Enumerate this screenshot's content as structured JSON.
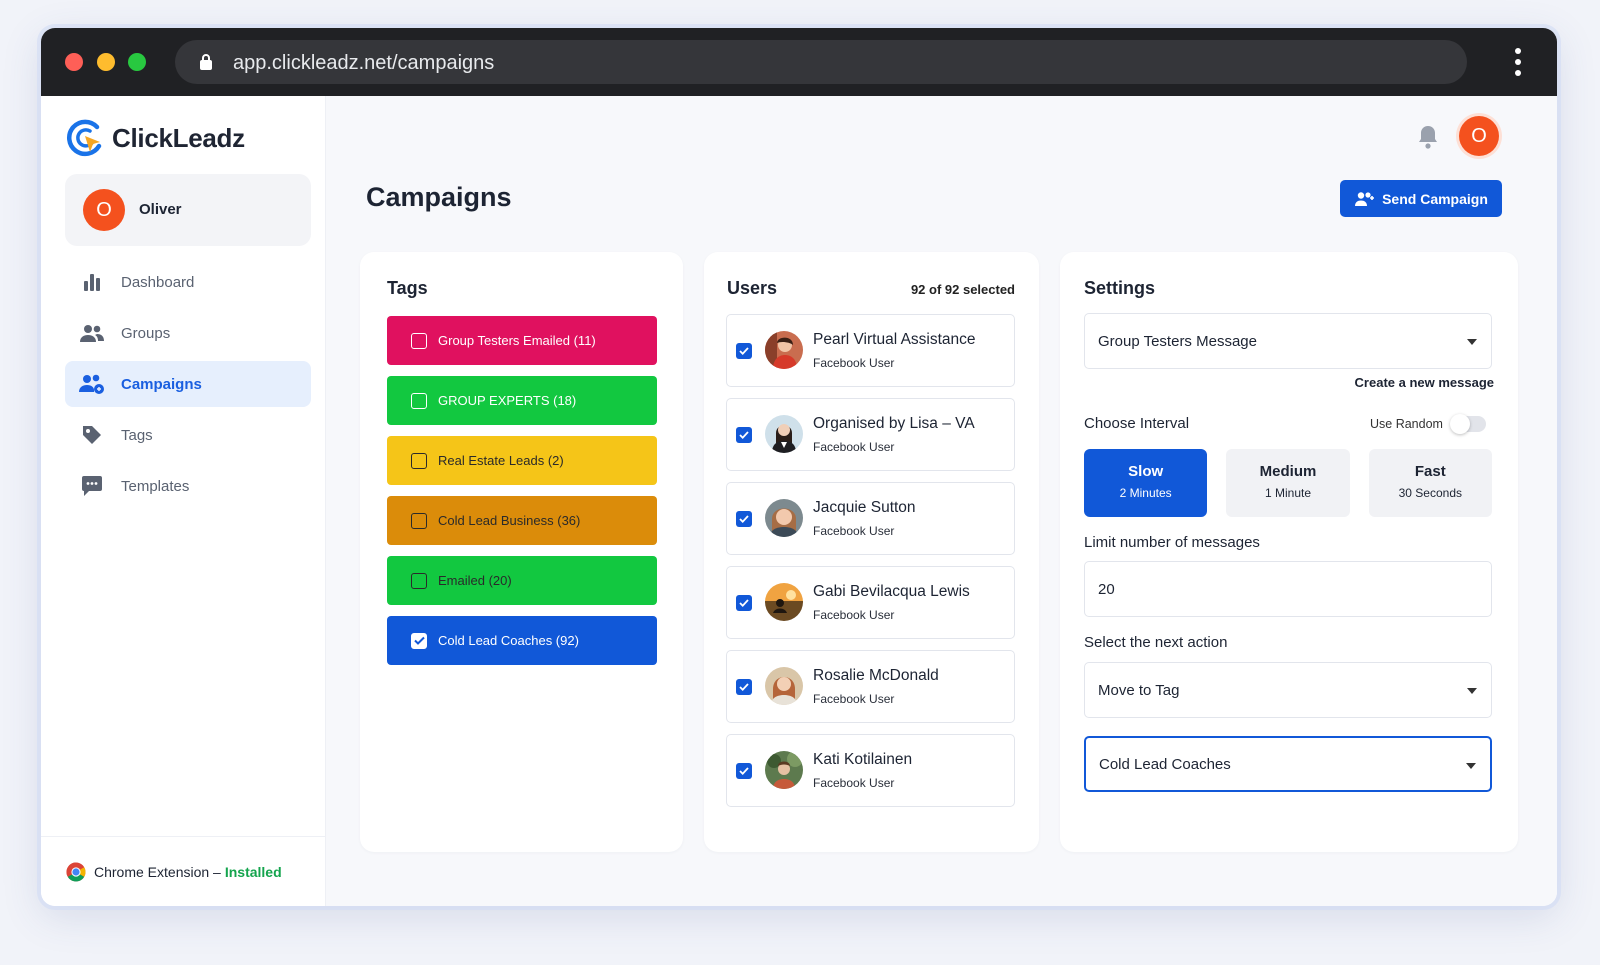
{
  "browser": {
    "url": "app.clickleadz.net/campaigns"
  },
  "app": {
    "brand": "ClickLeadz",
    "accent_color": "#1158d8"
  },
  "user": {
    "name": "Oliver",
    "initial": "O",
    "avatar_color": "#f4511e"
  },
  "sidebar": {
    "items": [
      {
        "label": "Dashboard",
        "icon": "bar-chart-icon",
        "active": false
      },
      {
        "label": "Groups",
        "icon": "group-icon",
        "active": false
      },
      {
        "label": "Campaigns",
        "icon": "campaign-users-icon",
        "active": true
      },
      {
        "label": "Tags",
        "icon": "tag-icon",
        "active": false
      },
      {
        "label": "Templates",
        "icon": "chat-bubble-icon",
        "active": false
      }
    ],
    "footer": {
      "label": "Chrome Extension –",
      "status": "Installed",
      "icon": "chrome-icon"
    }
  },
  "header": {
    "title": "Campaigns",
    "send_label": "Send Campaign",
    "bell_icon": "bell-icon"
  },
  "tags": {
    "title": "Tags",
    "items": [
      {
        "label": "Group Testers Emailed (11)",
        "color": "#e0115f",
        "checked": false
      },
      {
        "label": "GROUP EXPERTS (18)",
        "color": "#12c840",
        "checked": false
      },
      {
        "label": "Real Estate Leads (2)",
        "color": "#f5c518",
        "checked": false
      },
      {
        "label": "Cold Lead Business (36)",
        "color": "#db8c0a",
        "checked": false
      },
      {
        "label": "Emailed (20)",
        "color": "#12c840",
        "checked": false
      },
      {
        "label": "Cold Lead Coaches (92)",
        "color": "#1158d8",
        "checked": true
      }
    ]
  },
  "users": {
    "title": "Users",
    "selected_text": "92 of 92 selected",
    "items": [
      {
        "name": "Pearl Virtual Assistance",
        "subtitle": "Facebook User",
        "checked": true
      },
      {
        "name": "Organised by Lisa – VA",
        "subtitle": "Facebook User",
        "checked": true
      },
      {
        "name": "Jacquie Sutton",
        "subtitle": "Facebook User",
        "checked": true
      },
      {
        "name": "Gabi Bevilacqua Lewis",
        "subtitle": "Facebook User",
        "checked": true
      },
      {
        "name": "Rosalie McDonald",
        "subtitle": "Facebook User",
        "checked": true
      },
      {
        "name": "Kati Kotilainen",
        "subtitle": "Facebook User",
        "checked": true
      }
    ]
  },
  "settings": {
    "title": "Settings",
    "message_select": "Group Testers Message",
    "create_link": "Create a new message",
    "interval_label": "Choose Interval",
    "use_random_label": "Use Random",
    "use_random": false,
    "intervals": [
      {
        "title": "Slow",
        "sub": "2 Minutes",
        "active": true
      },
      {
        "title": "Medium",
        "sub": "1 Minute",
        "active": false
      },
      {
        "title": "Fast",
        "sub": "30 Seconds",
        "active": false
      }
    ],
    "limit_label": "Limit number of messages",
    "limit_value": "20",
    "next_action_label": "Select the next action",
    "next_action": "Move to Tag",
    "target_tag": "Cold Lead Coaches"
  }
}
